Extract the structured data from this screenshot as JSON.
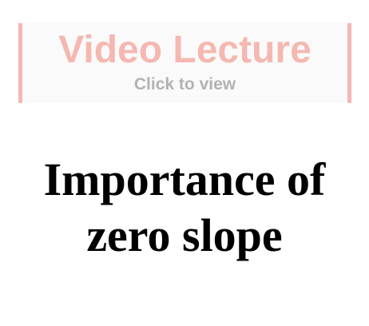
{
  "video_banner": {
    "title": "Video Lecture",
    "subtitle": "Click to view",
    "accent_color": "#f4b8b1",
    "subtitle_color": "#b2b2b2"
  },
  "lecture": {
    "title_line1": "Importance of",
    "title_line2": "zero slope"
  }
}
